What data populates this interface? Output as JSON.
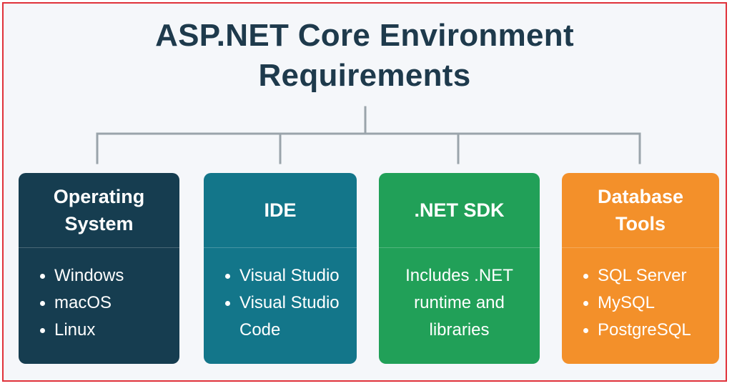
{
  "title": {
    "line1": "ASP.NET Core Environment",
    "line2": "Requirements"
  },
  "colors": {
    "frame_border": "#e0323a",
    "background": "#f5f7fa",
    "title": "#1e3a4c",
    "connector": "#9aa4ab",
    "operating_system": "#163d50",
    "ide": "#13768a",
    "net_sdk": "#21a058",
    "database_tools": "#f3902a"
  },
  "cards": {
    "operating_system": {
      "title_line1": "Operating",
      "title_line2": "System",
      "items": [
        "Windows",
        "macOS",
        "Linux"
      ]
    },
    "ide": {
      "title": "IDE",
      "item1": "Visual Studio",
      "item2_line1": "Visual Studio",
      "item2_line2": "Code"
    },
    "net_sdk": {
      "title": ".NET SDK",
      "description_line1": "Includes .NET",
      "description_line2": "runtime and",
      "description_line3": "libraries"
    },
    "database_tools": {
      "title_line1": "Database",
      "title_line2": "Tools",
      "items": [
        "SQL Server",
        "MySQL",
        "PostgreSQL"
      ]
    }
  }
}
